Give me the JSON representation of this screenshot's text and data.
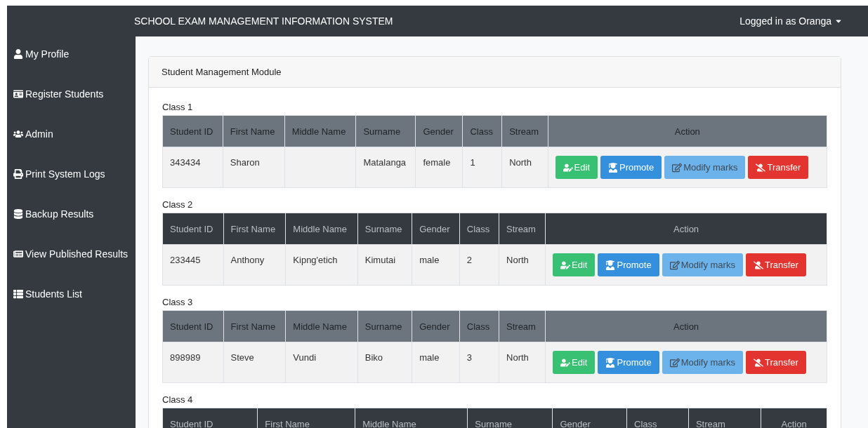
{
  "topbar": {
    "title": "SCHOOL EXAM MANAGEMENT INFORMATION SYSTEM",
    "user_menu": "Logged in as Oranga"
  },
  "sidebar": {
    "items": [
      {
        "label": "My Profile",
        "kind": "profile"
      },
      {
        "label": "Register Students",
        "kind": "register"
      },
      {
        "label": "Admin",
        "kind": "admin"
      },
      {
        "label": "Print System Logs",
        "kind": "print"
      },
      {
        "label": "Backup Results",
        "kind": "backup"
      },
      {
        "label": "View Published Results",
        "kind": "published"
      },
      {
        "label": "Students List",
        "kind": "list"
      }
    ]
  },
  "card": {
    "title": "Student Management Module",
    "sections": [
      {
        "label": "Class 1",
        "dark_header": false,
        "columns": [
          "Student ID",
          "First Name",
          "Middle Name",
          "Surname",
          "Gender",
          "Class",
          "Stream",
          "Action"
        ],
        "rows": [
          {
            "cells": [
              "343434",
              "Sharon",
              "",
              "Matalanga",
              "female",
              "1",
              "North"
            ],
            "actions": [
              {
                "label": "Edit",
                "kind": "edit"
              },
              {
                "label": "Promote",
                "kind": "promote"
              },
              {
                "label": "Modify marks",
                "kind": "modify"
              },
              {
                "label": "Transfer",
                "kind": "transfer"
              }
            ]
          }
        ]
      },
      {
        "label": "Class 2",
        "dark_header": true,
        "columns": [
          "Student ID",
          "First Name",
          "Middle Name",
          "Surname",
          "Gender",
          "Class",
          "Stream",
          "Action"
        ],
        "rows": [
          {
            "cells": [
              "233445",
              "Anthony",
              "Kipng'etich",
              "Kimutai",
              "male",
              "2",
              "North"
            ],
            "actions": [
              {
                "label": "Edit",
                "kind": "edit"
              },
              {
                "label": "Promote",
                "kind": "promote"
              },
              {
                "label": "Modify marks",
                "kind": "modify"
              },
              {
                "label": "Transfer",
                "kind": "transfer"
              }
            ]
          }
        ]
      },
      {
        "label": "Class 3",
        "dark_header": false,
        "columns": [
          "Student ID",
          "First Name",
          "Middle Name",
          "Surname",
          "Gender",
          "Class",
          "Stream",
          "Action"
        ],
        "rows": [
          {
            "cells": [
              "898989",
              "Steve",
              "Vundi",
              "Biko",
              "male",
              "3",
              "North"
            ],
            "actions": [
              {
                "label": "Edit",
                "kind": "edit"
              },
              {
                "label": "Promote",
                "kind": "promote"
              },
              {
                "label": "Modify marks",
                "kind": "modify"
              },
              {
                "label": "Transfer",
                "kind": "transfer"
              }
            ]
          }
        ]
      },
      {
        "label": "Class 4",
        "dark_header": true,
        "columns": [
          "Student ID",
          "First Name",
          "Middle Name",
          "Surname",
          "Gender",
          "Class",
          "Stream",
          "Action"
        ]
      }
    ]
  }
}
